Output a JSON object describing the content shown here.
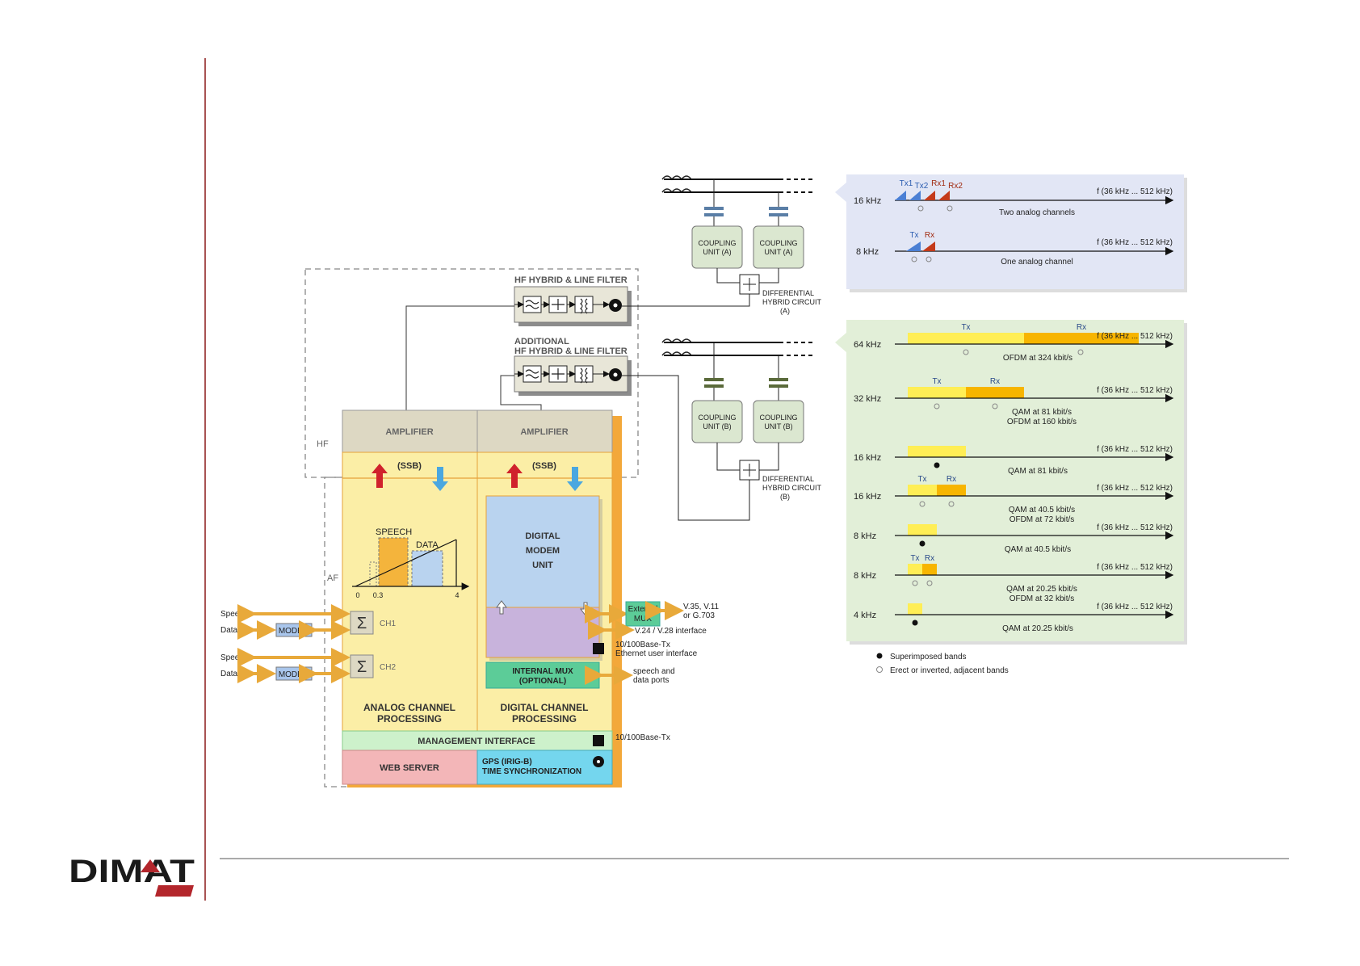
{
  "logo": {
    "text": "DIMAT",
    "colors": {
      "text": "#1a1a1a",
      "accent": "#b3262c"
    }
  },
  "colors": {
    "page_rule": "#8b1a1a",
    "amplifier": "#ddd8c3",
    "processing": "#fbeea6",
    "digital_modem": "#b9d3ef",
    "purple": "#c8b3dc",
    "internal_mux": "#5ccc98",
    "management": "#cdf1cb",
    "web_server": "#f3b6b8",
    "gps": "#74d6ee",
    "coupling": "#dbe7d0",
    "panel_analog": "#e2e6f5",
    "panel_digital": "#e2efd8",
    "band_yellow": "#ffee55",
    "band_orange": "#f7b500",
    "tx_blue": "#4a7fd4",
    "rx_red": "#c43a1a"
  },
  "block": {
    "hf_label": "HF",
    "af_label": "AF",
    "hf_hybrid_title": "HF HYBRID & LINE FILTER",
    "additional_hf_hybrid_title": [
      "ADDITIONAL",
      "HF HYBRID & LINE FILTER"
    ],
    "amplifier_labels": [
      "AMPLIFIER",
      "AMPLIFIER"
    ],
    "ssb_labels": [
      "(SSB)",
      "(SSB)"
    ],
    "spectrum": {
      "speech": "SPEECH",
      "data": "DATA",
      "ticks": [
        "0",
        "0.3",
        "4"
      ]
    },
    "channels": [
      {
        "speech": "Speech",
        "data": "Data",
        "modem": "MODEM",
        "name": "CH1"
      },
      {
        "speech": "Speech",
        "data": "Data",
        "modem": "MODEM",
        "name": "CH2"
      }
    ],
    "digital_modem": [
      "DIGITAL",
      "MODEM",
      "UNIT"
    ],
    "internal_mux": [
      "INTERNAL MUX",
      "(OPTIONAL)"
    ],
    "analog_processing": [
      "ANALOG CHANNEL",
      "PROCESSING"
    ],
    "digital_processing": [
      "DIGITAL CHANNEL",
      "PROCESSING"
    ],
    "management_interface": "MANAGEMENT INTERFACE",
    "web_server": "WEB SERVER",
    "gps": [
      "GPS (IRIG-B)",
      "TIME SYNCHRONIZATION"
    ],
    "external_mux": [
      "External",
      "MUX"
    ],
    "interfaces": {
      "v35": [
        "V.35, V.11",
        "or G.703"
      ],
      "v24": "V.24 / V.28 interface",
      "ethernet": [
        "10/100Base-Tx",
        "Ethernet user interface"
      ],
      "speech_data_ports": [
        "speech and",
        "data ports"
      ],
      "mgmt_eth": "10/100Base-Tx"
    }
  },
  "line": {
    "coupling_a": [
      "COUPLING",
      "UNIT (A)"
    ],
    "coupling_b": [
      "COUPLING",
      "UNIT (B)"
    ],
    "diff_a": [
      "DIFFERENTIAL",
      "HYBRID CIRCUIT",
      "(A)"
    ],
    "diff_b": [
      "DIFFERENTIAL",
      "HYBRID CIRCUIT",
      "(B)"
    ]
  },
  "analog_panel": {
    "freq_range": "f (36 kHz ... 512 kHz)",
    "rows": [
      {
        "bw": "16 kHz",
        "labels": [
          "Tx1",
          "Tx2",
          "Rx1",
          "Rx2"
        ],
        "caption": "Two analog channels"
      },
      {
        "bw": "8 kHz",
        "labels": [
          "Tx",
          "Rx"
        ],
        "caption": "One analog channel"
      }
    ]
  },
  "digital_panel": {
    "freq_range": "f (36 kHz ... 512 kHz)",
    "rows": [
      {
        "bw": "64 kHz",
        "labels": [
          "Tx",
          "Rx"
        ],
        "caption": [
          "OFDM at 324 kbit/s"
        ]
      },
      {
        "bw": "32 kHz",
        "labels": [
          "Tx",
          "Rx"
        ],
        "caption": [
          "QAM at 81 kbit/s",
          "OFDM at 160 kbit/s"
        ]
      },
      {
        "bw": "16 kHz",
        "labels": [],
        "caption": [
          "QAM at 81 kbit/s"
        ]
      },
      {
        "bw": "16 kHz",
        "labels": [
          "Tx",
          "Rx"
        ],
        "caption": [
          "QAM at 40.5 kbit/s",
          "OFDM at 72 kbit/s"
        ]
      },
      {
        "bw": "8 kHz",
        "labels": [],
        "caption": [
          "QAM at 40.5 kbit/s"
        ]
      },
      {
        "bw": "8 kHz",
        "labels": [
          "Tx",
          "Rx"
        ],
        "caption": [
          "QAM at 20.25 kbit/s",
          "OFDM at 32 kbit/s"
        ]
      },
      {
        "bw": "4 kHz",
        "labels": [],
        "caption": [
          "QAM at 20.25 kbit/s"
        ]
      }
    ],
    "legend": [
      {
        "symbol": "filled",
        "text": "Superimposed bands"
      },
      {
        "symbol": "hollow",
        "text": "Erect or inverted, adjacent bands"
      }
    ]
  }
}
